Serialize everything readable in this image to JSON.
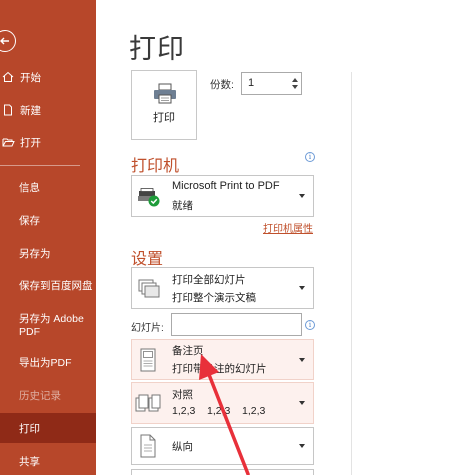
{
  "sidebar": {
    "items": [
      {
        "label": "开始"
      },
      {
        "label": "新建"
      },
      {
        "label": "打开"
      },
      {
        "label": "信息"
      },
      {
        "label": "保存"
      },
      {
        "label": "另存为"
      },
      {
        "label": "保存到百度网盘"
      },
      {
        "label": "另存为 Adobe PDF"
      },
      {
        "label": "导出为PDF"
      },
      {
        "label": "历史记录"
      },
      {
        "label": "打印"
      },
      {
        "label": "共享"
      }
    ]
  },
  "main": {
    "title": "打印",
    "print_button_label": "打印",
    "copies_label": "份数:",
    "copies_value": "1",
    "printer_section": "打印机",
    "printer_name": "Microsoft Print to PDF",
    "printer_status": "就绪",
    "printer_properties_link": "打印机属性",
    "settings_section": "设置",
    "range_title": "打印全部幻灯片",
    "range_desc": "打印整个演示文稿",
    "slides_label": "幻灯片:",
    "slides_value": "",
    "layout_title": "备注页",
    "layout_desc": "打印带备注的幻灯片",
    "collate_title": "对照",
    "collate_desc": "1,2,3    1,2,3    1,2,3",
    "orientation": "纵向"
  },
  "colors": {
    "sidebar_bg": "#b7472a",
    "sidebar_selected": "#8f2a17",
    "accent": "#c0502c",
    "highlight_bg": "#fdf1ee",
    "arrow": "#e8303a"
  }
}
